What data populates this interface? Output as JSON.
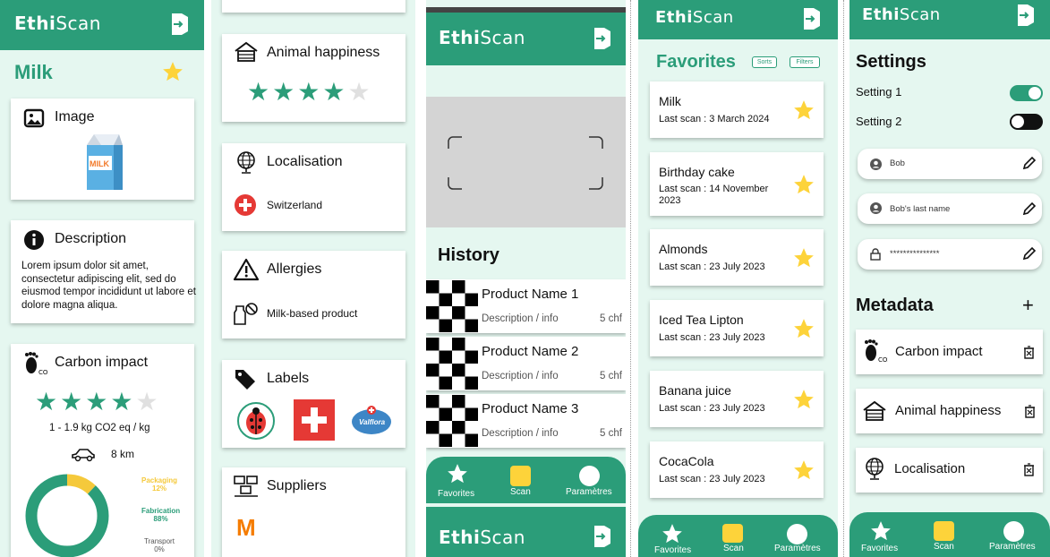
{
  "app": {
    "logo_bold": "Ethi",
    "logo_light": "Scan"
  },
  "colors": {
    "primary": "#2b9d79",
    "background": "#e5f7f0",
    "star": "#fdd33a",
    "danger": "#e53935"
  },
  "screen1": {
    "product_title": "Milk",
    "image_card": {
      "title": "Image",
      "icon": "image-icon",
      "product_image": "milk-carton",
      "carton_text": "MILK"
    },
    "description_card": {
      "title": "Description",
      "text": "Lorem ipsum dolor sit amet, consectetur adipiscing elit, sed do eiusmod tempor incididunt ut labore et dolore magna aliqua."
    },
    "carbon_card": {
      "title": "Carbon impact",
      "rating": 4,
      "max_rating": 5,
      "value_text": "1 - 1.9 kg CO2 eq / kg",
      "distance": "8 km",
      "breakdown": [
        {
          "label": "Packaging",
          "value": "12%",
          "fraction": 0.12,
          "color": "#f5c93b"
        },
        {
          "label": "Fabrication",
          "value": "88%",
          "fraction": 0.88,
          "color": "#2b9d79"
        },
        {
          "label": "Transport",
          "value": "0%",
          "fraction": 0,
          "color": "#666666"
        }
      ]
    }
  },
  "screen2": {
    "animal_card": {
      "title": "Animal happiness",
      "rating": 4,
      "max_rating": 5
    },
    "localisation_card": {
      "title": "Localisation",
      "country": "Switzerland"
    },
    "allergies_card": {
      "title": "Allergies",
      "item": "Milk-based product"
    },
    "labels_card": {
      "title": "Labels",
      "badges": [
        "ladybug-label",
        "swiss-flag-label",
        "valflora-label"
      ],
      "valflora_text": "Valflora"
    },
    "suppliers_card": {
      "title": "Suppliers",
      "supplier_logo": "M"
    }
  },
  "screen3": {
    "history_title": "History",
    "items": [
      {
        "name": "Product Name 1",
        "desc": "Description / info",
        "price": "5 chf"
      },
      {
        "name": "Product Name 2",
        "desc": "Description / info",
        "price": "5 chf"
      },
      {
        "name": "Product Name 3",
        "desc": "Description / info",
        "price": "5 chf"
      }
    ],
    "nav": {
      "favorites": "Favorites",
      "scan": "Scan",
      "settings": "Paramètres"
    }
  },
  "screen4": {
    "title": "Favorites",
    "sorts_label": "Sorts",
    "filters_label": "Filters",
    "items": [
      {
        "name": "Milk",
        "date": "Last scan : 3 March 2024"
      },
      {
        "name": "Birthday cake",
        "date": "Last scan : 14 November 2023"
      },
      {
        "name": "Almonds",
        "date": "Last scan : 23 July 2023"
      },
      {
        "name": "Iced Tea Lipton",
        "date": "Last scan : 23 July 2023"
      },
      {
        "name": "Banana juice",
        "date": "Last scan : 23 July 2023"
      },
      {
        "name": "CocaCola",
        "date": "Last scan : 23 July 2023"
      }
    ],
    "nav": {
      "favorites": "Favorites",
      "scan": "Scan",
      "settings": "Paramètres"
    }
  },
  "screen5": {
    "settings_title": "Settings",
    "settings": [
      {
        "label": "Setting 1",
        "on": true
      },
      {
        "label": "Setting 2",
        "on": false
      }
    ],
    "fields": [
      {
        "value": "Bob",
        "icon": "person-icon"
      },
      {
        "value": "Bob's last name",
        "icon": "person-icon"
      },
      {
        "value": "***************",
        "icon": "lock-icon"
      }
    ],
    "metadata_title": "Metadata",
    "add_symbol": "+",
    "metadata_items": [
      {
        "label": "Carbon impact",
        "icon": "footprint-icon"
      },
      {
        "label": "Animal happiness",
        "icon": "farm-icon"
      },
      {
        "label": "Localisation",
        "icon": "globe-icon"
      }
    ],
    "nav": {
      "favorites": "Favorites",
      "scan": "Scan",
      "settings": "Paramètres"
    }
  }
}
